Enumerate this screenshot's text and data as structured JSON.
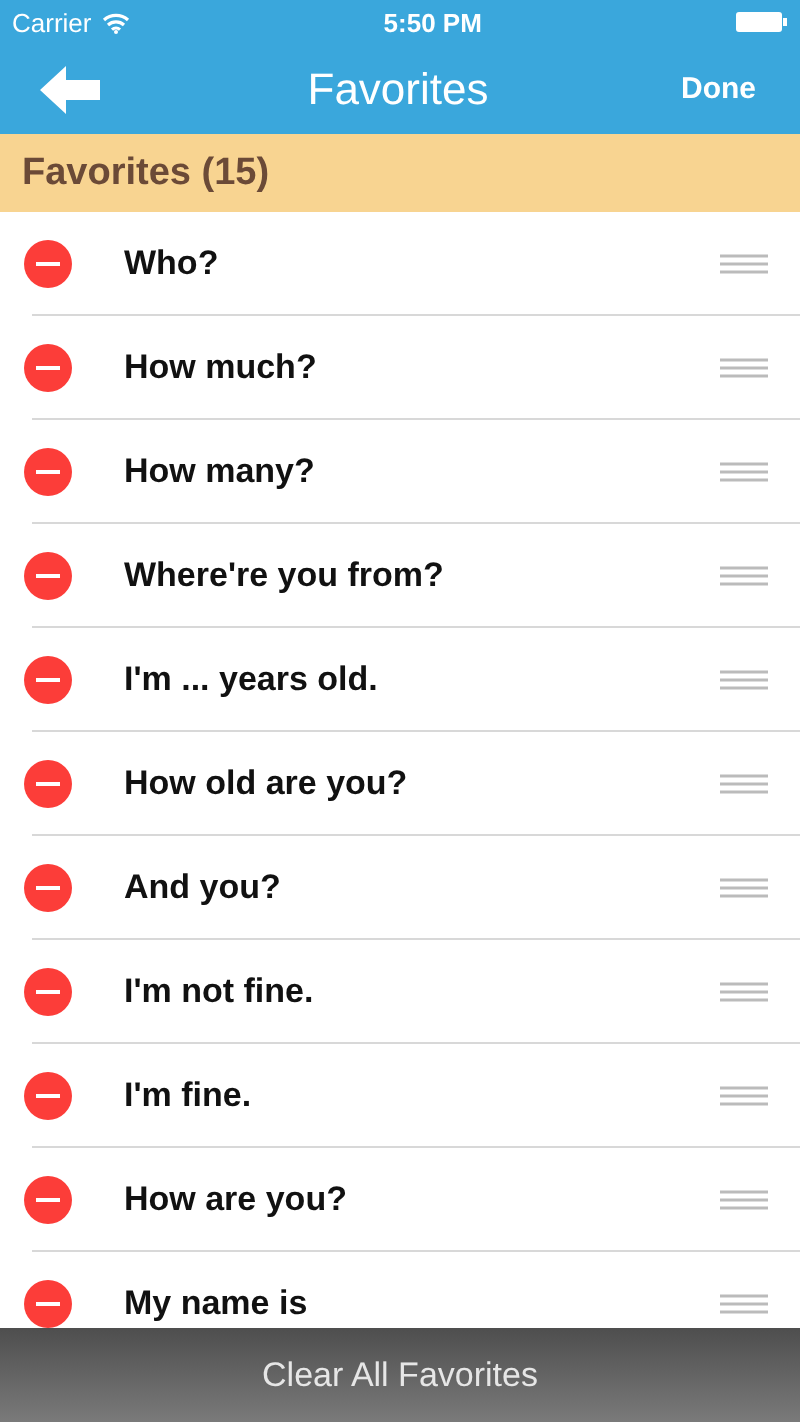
{
  "status_bar": {
    "carrier": "Carrier",
    "time": "5:50 PM"
  },
  "nav": {
    "title": "Favorites",
    "action": "Done"
  },
  "section": {
    "title": "Favorites (15)"
  },
  "rows": [
    {
      "text": "Who?"
    },
    {
      "text": "How much?"
    },
    {
      "text": "How many?"
    },
    {
      "text": "Where're you from?"
    },
    {
      "text": "I'm ... years old."
    },
    {
      "text": "How old are you?"
    },
    {
      "text": "And you?"
    },
    {
      "text": "I'm not fine."
    },
    {
      "text": "I'm fine."
    },
    {
      "text": "How are you?"
    },
    {
      "text": "My name is"
    }
  ],
  "footer": {
    "button": "Clear All Favorites"
  }
}
